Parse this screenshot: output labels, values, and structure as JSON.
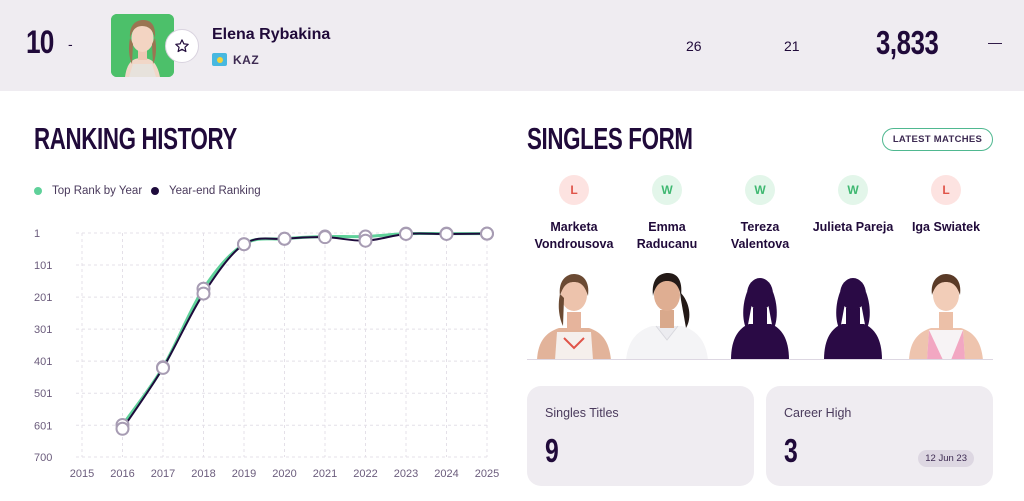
{
  "player": {
    "rank": "10",
    "rank_change": "-",
    "name": "Elena Rybakina",
    "country": "KAZ",
    "stat_a": "26",
    "stat_b": "21",
    "points": "3,833",
    "points_change": "—"
  },
  "ranking_history": {
    "title": "RANKING HISTORY",
    "legend": [
      {
        "label": "Top Rank by Year",
        "color": "#5fd19a"
      },
      {
        "label": "Year-end Ranking",
        "color": "#1e0b3c"
      }
    ]
  },
  "chart_data": {
    "type": "line",
    "x": [
      2015,
      2016,
      2017,
      2018,
      2019,
      2020,
      2021,
      2022,
      2023,
      2024,
      2025
    ],
    "ylim": [
      700,
      1
    ],
    "y_ticks": [
      "1",
      "101",
      "201",
      "301",
      "401",
      "501",
      "601",
      "700"
    ],
    "x_ticks": [
      "2015",
      "2016",
      "2017",
      "2018",
      "2019",
      "2020",
      "2021",
      "2022",
      "2023",
      "2024",
      "2025"
    ],
    "series": [
      {
        "name": "Top Rank by Year",
        "color": "#5fd19a",
        "x": [
          2016,
          2017,
          2018,
          2019,
          2020,
          2021,
          2022,
          2023,
          2024,
          2025
        ],
        "values": [
          600,
          420,
          175,
          36,
          19,
          12,
          12,
          3,
          3,
          3
        ]
      },
      {
        "name": "Year-end Ranking",
        "color": "#1e0b3c",
        "x": [
          2016,
          2017,
          2018,
          2019,
          2020,
          2021,
          2022,
          2023,
          2024,
          2025
        ],
        "values": [
          612,
          422,
          190,
          36,
          19,
          14,
          25,
          4,
          4,
          3
        ]
      }
    ],
    "grid": true
  },
  "singles_form": {
    "title": "SINGLES FORM",
    "latest_button": "LATEST MATCHES",
    "matches": [
      {
        "result": "L",
        "opponent": "Marketa Vondrousova",
        "photo": "player-photo"
      },
      {
        "result": "W",
        "opponent": "Emma Raducanu",
        "photo": "player-photo"
      },
      {
        "result": "W",
        "opponent": "Tereza Valentova",
        "photo": "silhouette"
      },
      {
        "result": "W",
        "opponent": "Julieta Pareja",
        "photo": "silhouette"
      },
      {
        "result": "L",
        "opponent": "Iga Swiatek",
        "photo": "player-photo"
      }
    ]
  },
  "cards": {
    "singles_titles": {
      "label": "Singles Titles",
      "value": "9"
    },
    "career_high": {
      "label": "Career High",
      "value": "3",
      "date": "12 Jun 23"
    }
  },
  "colors": {
    "brand_dark": "#200a3a",
    "accent_green": "#5fd19a",
    "loss_red": "#e05449",
    "win_green": "#3fb871",
    "header_bg": "#efecf1"
  },
  "icons": [
    "star-icon",
    "kaz-flag-icon"
  ]
}
